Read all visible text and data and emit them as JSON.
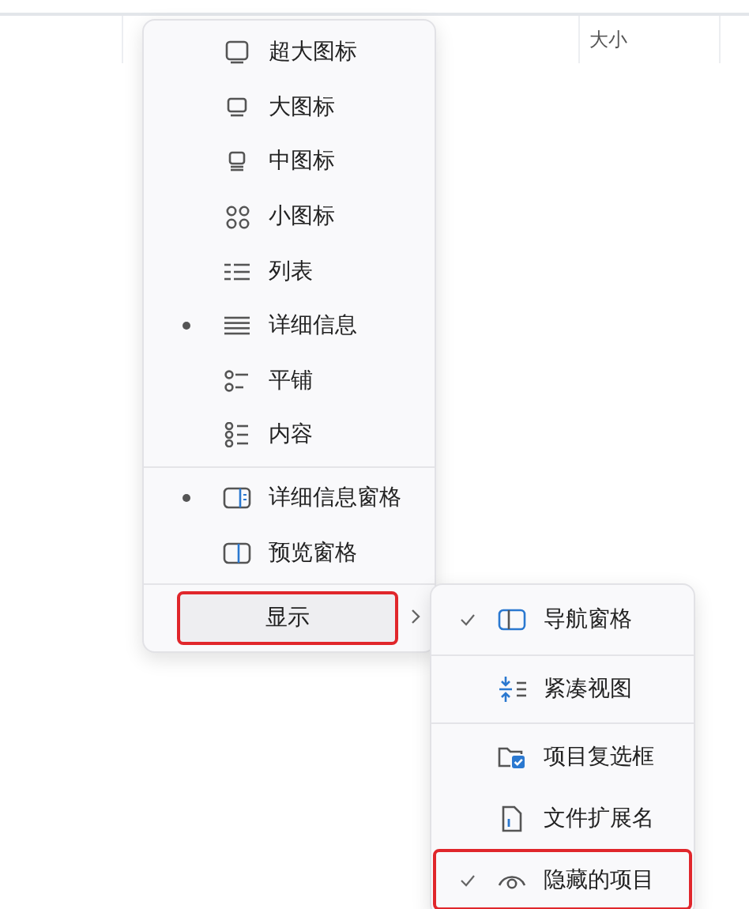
{
  "table": {
    "columns": [
      {
        "label": "大小"
      }
    ]
  },
  "view_menu": {
    "items": [
      {
        "kind": "item",
        "label": "超大图标",
        "selected": false
      },
      {
        "kind": "item",
        "label": "大图标",
        "selected": false
      },
      {
        "kind": "item",
        "label": "中图标",
        "selected": false
      },
      {
        "kind": "item",
        "label": "小图标",
        "selected": false
      },
      {
        "kind": "item",
        "label": "列表",
        "selected": false
      },
      {
        "kind": "item",
        "label": "详细信息",
        "selected": true
      },
      {
        "kind": "item",
        "label": "平铺",
        "selected": false
      },
      {
        "kind": "item",
        "label": "内容",
        "selected": false
      },
      {
        "kind": "separator"
      },
      {
        "kind": "item",
        "label": "详细信息窗格",
        "selected": true
      },
      {
        "kind": "item",
        "label": "预览窗格",
        "selected": false
      },
      {
        "kind": "separator"
      },
      {
        "kind": "submenu",
        "label": "显示",
        "annotated": true
      }
    ]
  },
  "show_submenu": {
    "items": [
      {
        "kind": "item",
        "label": "导航窗格",
        "checked": true,
        "annotated": false
      },
      {
        "kind": "separator"
      },
      {
        "kind": "item",
        "label": "紧凑视图",
        "checked": false,
        "annotated": false
      },
      {
        "kind": "separator"
      },
      {
        "kind": "item",
        "label": "项目复选框",
        "checked": false,
        "annotated": false
      },
      {
        "kind": "item",
        "label": "文件扩展名",
        "checked": false,
        "annotated": false
      },
      {
        "kind": "item",
        "label": "隐藏的项目",
        "checked": true,
        "annotated": true
      }
    ]
  }
}
